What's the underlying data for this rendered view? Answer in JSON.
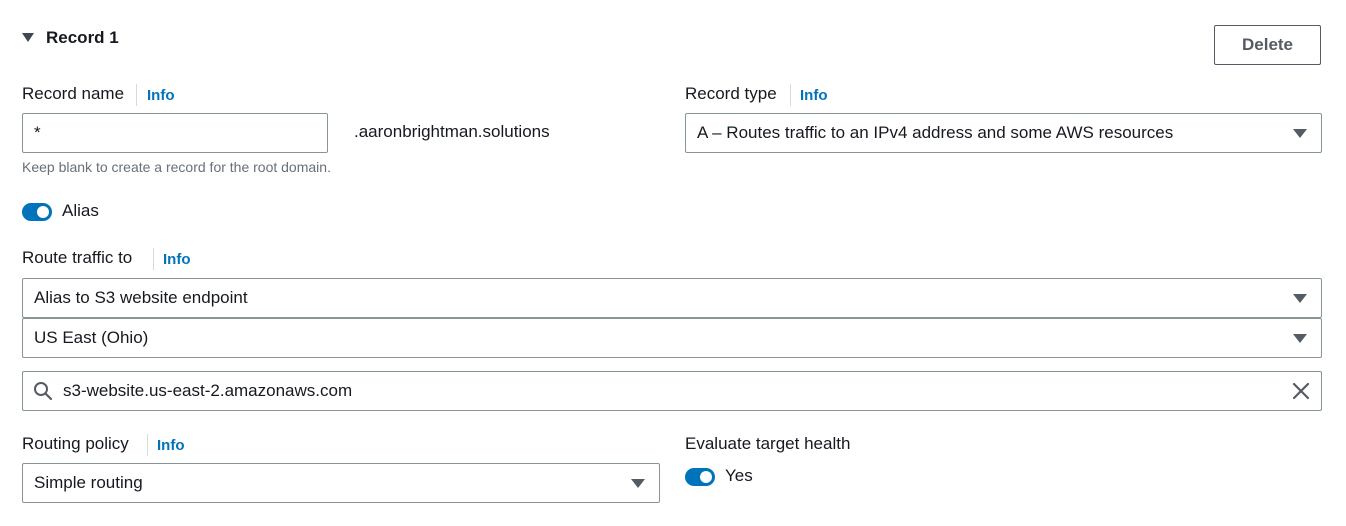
{
  "section": {
    "title": "Record 1",
    "delete_label": "Delete"
  },
  "record_name": {
    "label": "Record name",
    "info": "Info",
    "value": "*",
    "suffix": ".aaronbrightman.solutions",
    "hint": "Keep blank to create a record for the root domain."
  },
  "record_type": {
    "label": "Record type",
    "info": "Info",
    "selected": "A – Routes traffic to an IPv4 address and some AWS resources"
  },
  "alias": {
    "label": "Alias",
    "enabled": true
  },
  "route_traffic": {
    "label": "Route traffic to",
    "info": "Info",
    "endpoint_selected": "Alias to S3 website endpoint",
    "region_selected": "US East (Ohio)",
    "search_value": "s3-website.us-east-2.amazonaws.com"
  },
  "routing_policy": {
    "label": "Routing policy",
    "info": "Info",
    "selected": "Simple routing"
  },
  "evaluate_health": {
    "label": "Evaluate target health",
    "toggle_label": "Yes",
    "enabled": true
  },
  "colors": {
    "accent": "#0073bb",
    "text": "#16191f",
    "border": "#879596",
    "hint": "#687078"
  },
  "icons": [
    "caret-down-icon",
    "select-arrow-icon",
    "search-icon",
    "clear-icon"
  ]
}
